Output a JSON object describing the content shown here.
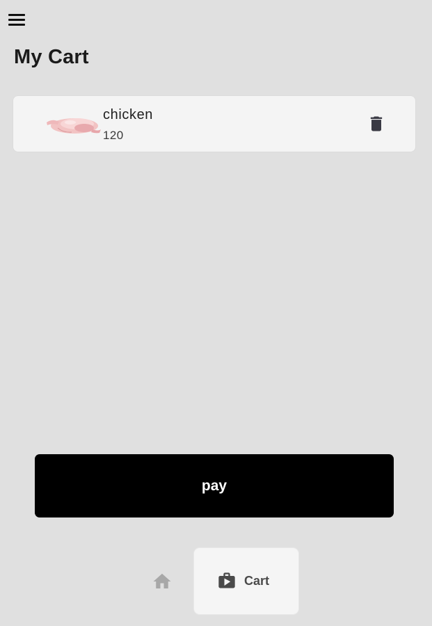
{
  "header": {
    "menu_icon": "hamburger-menu-icon",
    "title": "My Cart"
  },
  "cart": {
    "items": [
      {
        "name": "chicken",
        "price": "120",
        "image_icon": "raw-chicken-image",
        "delete_icon": "trash-icon"
      }
    ]
  },
  "pay_button": {
    "label": "pay"
  },
  "bottom_nav": {
    "items": [
      {
        "icon": "home-icon",
        "label": "",
        "active": false
      },
      {
        "icon": "shopping-bag-icon",
        "label": "Cart",
        "active": true
      }
    ]
  },
  "colors": {
    "background": "#e0e0e0",
    "card": "#f4f4f4",
    "pay_button": "#000000",
    "icon_dark": "#3a3a44",
    "icon_inactive": "#a8a8a8"
  }
}
